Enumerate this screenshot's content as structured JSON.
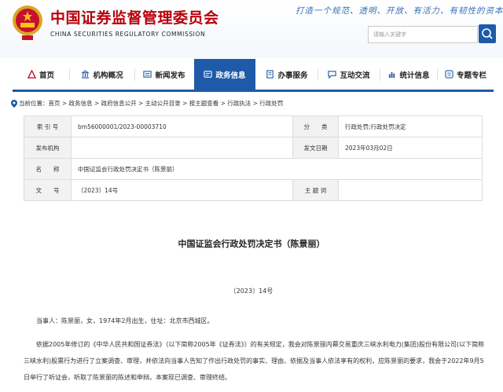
{
  "header": {
    "title_cn": "中国证券监督管理委员会",
    "title_en": "CHINA SECURITIES REGULATORY COMMISSION",
    "slogan": "打造一个规范、透明、开放、有活力、有韧性的资本市场",
    "search_placeholder": "请输入关键字"
  },
  "nav": {
    "items": [
      {
        "label": "首页",
        "icon": "home-icon"
      },
      {
        "label": "机构概况",
        "icon": "building-icon"
      },
      {
        "label": "新闻发布",
        "icon": "news-icon"
      },
      {
        "label": "政务信息",
        "icon": "gov-info-icon"
      },
      {
        "label": "办事服务",
        "icon": "service-icon"
      },
      {
        "label": "互动交流",
        "icon": "chat-icon"
      },
      {
        "label": "统计信息",
        "icon": "chart-icon"
      },
      {
        "label": "专题专栏",
        "icon": "topic-icon"
      }
    ],
    "active_index": 3
  },
  "breadcrumb": {
    "prefix": "当前位置：",
    "text": "首页 > 政务信息 > 政府信息公开 > 主动公开目录 > 按主题查看 > 行政执法 > 行政处罚"
  },
  "meta": {
    "index_label": "索 引 号",
    "index_value": "bm56000001/2023-00003710",
    "category_label": "分　　类",
    "category_value": "行政处罚;行政处罚决定",
    "issuer_label": "发布机构",
    "issuer_value": "",
    "date_label": "发文日期",
    "date_value": "2023年03月02日",
    "name_label": "名　　称",
    "name_value": "中国证监会行政处罚决定书（陈景丽）",
    "docno_label": "文　　号",
    "docno_value": "〔2023〕14号",
    "keyword_label": "主 题 词",
    "keyword_value": ""
  },
  "article": {
    "title": "中国证监会行政处罚决定书（陈景丽）",
    "number": "〔2023〕14号",
    "para1": "当事人：陈景丽，女，1974年2月出生，住址：北京市西城区。",
    "para2": "依据2005年修订的《中华人民共和国证券法》（以下简称2005年《证券法》）的有关规定，我会对陈景丽内幕交易重庆三峡水利电力(集团)股份有限公司(以下简称三峡水利)股票行为进行了立案调查、审理，并依法向当事人告知了作出行政处罚的事实、理由、依据及当事人依法享有的权利，应陈景丽的要求，我会于2022年9月5日举行了听证会，听取了陈景丽的陈述和申辩。本案现已调查、审理终结。"
  },
  "colors": {
    "brand_red": "#b8000b",
    "nav_blue": "#1e5aa8",
    "slogan_blue": "#3a70b8"
  }
}
